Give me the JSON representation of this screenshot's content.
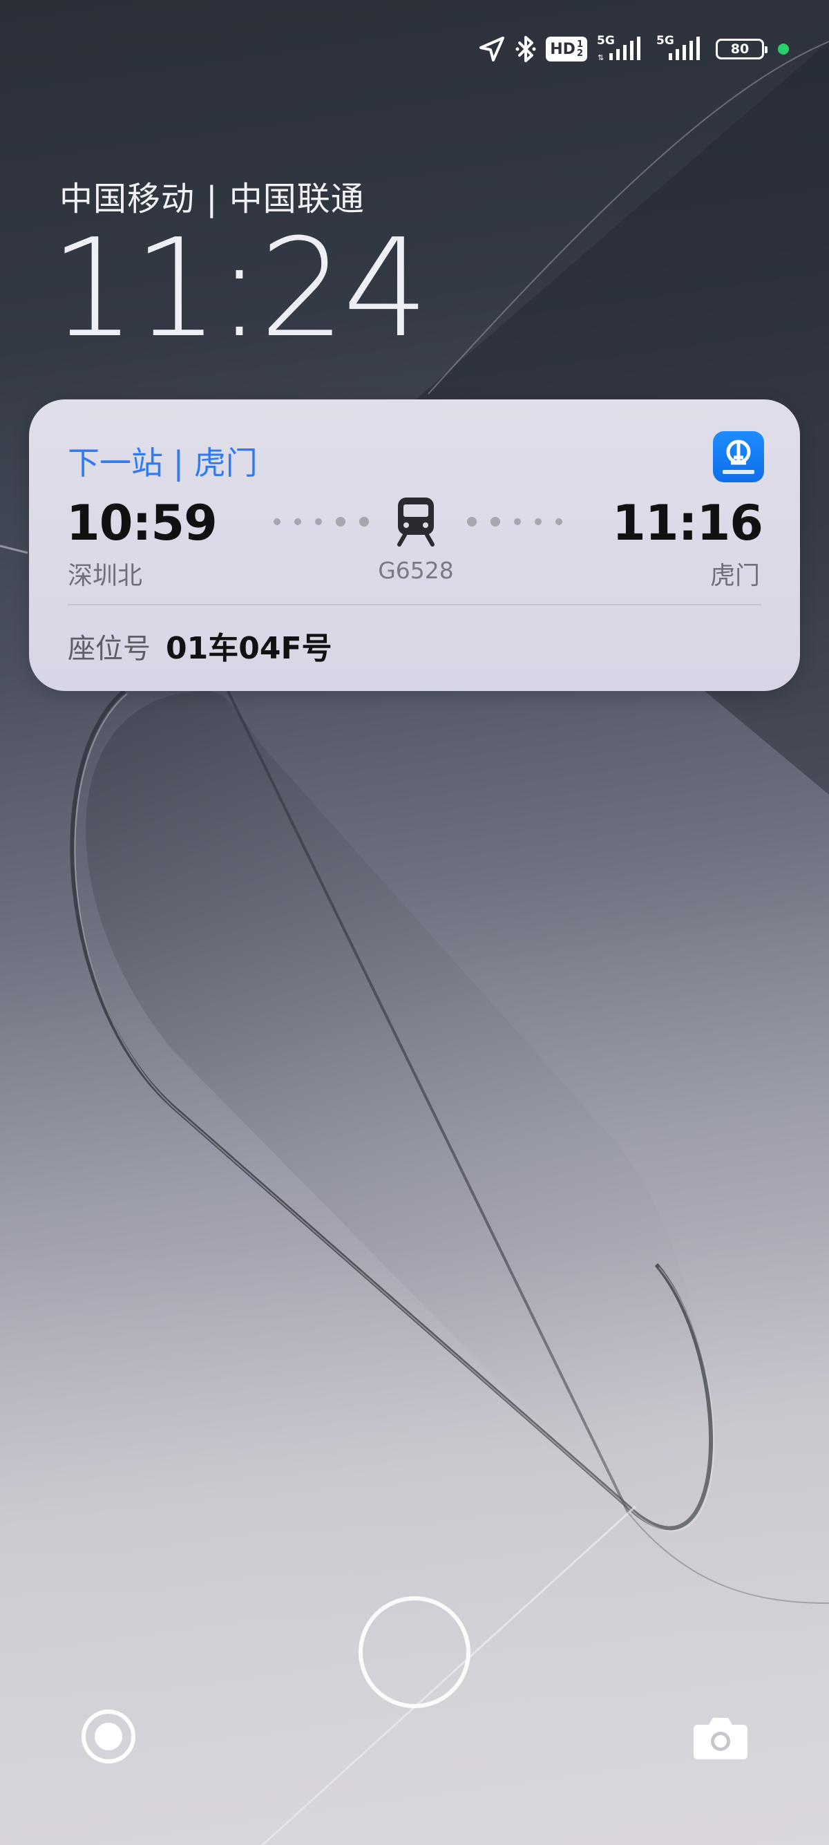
{
  "status_bar": {
    "icons": [
      "location-arrow-icon",
      "bluetooth-icon",
      "hd-volte-icon",
      "signal-5g-icon",
      "signal-5g-icon",
      "battery-icon"
    ],
    "hd_label": "HD",
    "net1_label": "5G",
    "net2_label": "5G",
    "battery_level": "80",
    "indicator_color": "#27d06c"
  },
  "lockscreen": {
    "carrier": "中国移动 | 中国联通",
    "time": "11:24"
  },
  "train_card": {
    "header": "下一站 | 虎门",
    "app_icon": "railway-12306-icon",
    "departure": {
      "time": "10:59",
      "station": "深圳北"
    },
    "arrival": {
      "time": "11:16",
      "station": "虎门"
    },
    "train_number": "G6528",
    "seat_label": "座位号",
    "seat_value": "01车04F号",
    "accent_color": "#2f7bf5"
  },
  "bottom": {
    "left_icon": "record-circle-icon",
    "center_icon": "unlock-ring-icon",
    "right_icon": "camera-icon"
  }
}
